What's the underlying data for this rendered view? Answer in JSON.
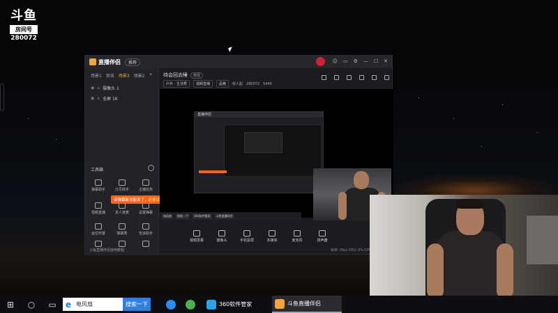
{
  "overlay_logo": {
    "mark": "斗鱼",
    "badge": "房间号",
    "room_number": "280072"
  },
  "app": {
    "title": "直播伴侣",
    "guide": "推荐",
    "window_buttons": [
      "☺",
      "▭",
      "⚙",
      "—",
      "☐",
      "✕"
    ],
    "sidebar": {
      "tabs": [
        "场景1",
        "双击",
        "场景3",
        "场景2",
        "+"
      ],
      "active_tab_index": 2,
      "sources": [
        {
          "icon": "eye-icon",
          "label": "摄像头 1"
        },
        {
          "icon": "eye-icon",
          "label": "全屏 16"
        }
      ],
      "tools_title": "工具箱",
      "tools": [
        {
          "label": "弹幕助手"
        },
        {
          "label": "分贝助手"
        },
        {
          "label": "主播任务"
        },
        {
          "label": "视频直播"
        },
        {
          "label": "多人连麦"
        },
        {
          "label": "设置弹幕"
        },
        {
          "label": "运位布置"
        },
        {
          "label": "弹幕秀"
        },
        {
          "label": "告诉助手"
        },
        {
          "label": "更多"
        },
        {
          "label": "下载"
        },
        {
          "label": "主播"
        }
      ],
      "tip_text": "该弹幕新功能来了，",
      "tip_link": "赶紧试试吧~",
      "footer": "斗鱼直播伴侣使用教程"
    },
    "room_title": "待会回去睡",
    "room_edit": "修改",
    "meta": {
      "category": "户外 - 生活秀",
      "quality": "视频直播",
      "tag": "品格",
      "followers": "房人起",
      "room": "280072",
      "heat": "5440"
    },
    "bottom_bar": [
      {
        "icon": "screen-icon",
        "label": "视频屏幕"
      },
      {
        "icon": "camera-icon",
        "label": "摄像头"
      },
      {
        "icon": "phone-icon",
        "label": "手机投屏"
      },
      {
        "icon": "video-icon",
        "label": "多媒体"
      },
      {
        "icon": "mic-icon",
        "label": "麦克风"
      },
      {
        "icon": "speaker-icon",
        "label": "扬声器"
      }
    ],
    "status": "帧率: 0fps   CPU: 0%   CPU: 21%   内存: 0%"
  },
  "nested_window": {
    "title": "直播伴侣"
  },
  "mini_taskbar": [
    "电风扇",
    "搜索一下",
    "360软件管家",
    "斗鱼直播伴侣"
  ],
  "taskbar": {
    "search_value": "电风扇",
    "search_button": "搜索一下",
    "apps": [
      {
        "label": "360软件管家",
        "color": "#2aa3e8"
      },
      {
        "label": "斗鱼直播伴侣",
        "color": "#f2a541"
      }
    ]
  }
}
